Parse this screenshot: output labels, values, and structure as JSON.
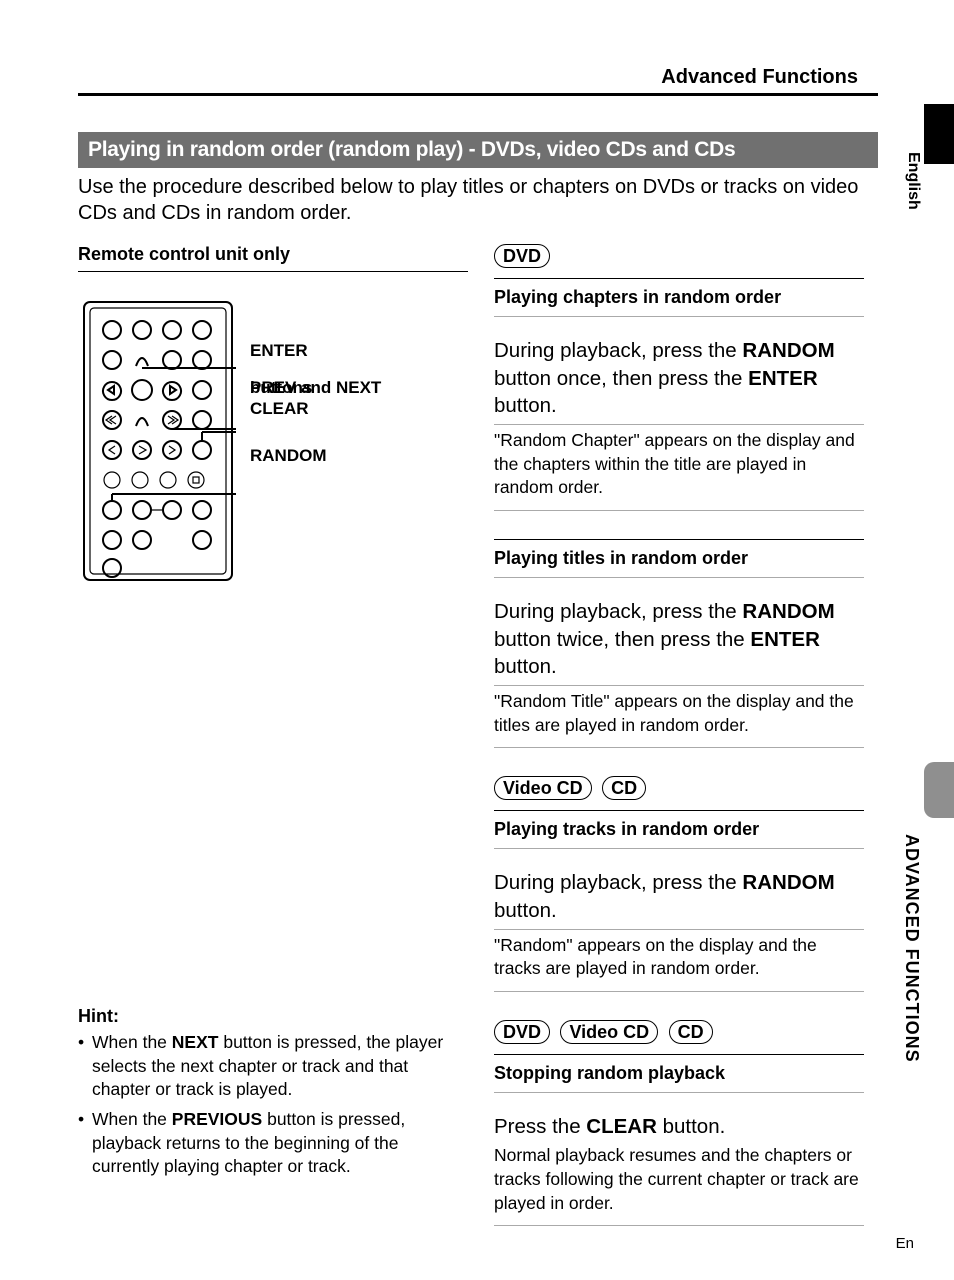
{
  "header": {
    "title": "Advanced Functions"
  },
  "side": {
    "language": "English",
    "section": "ADVANCED FUNCTIONS"
  },
  "footer": {
    "code": "En"
  },
  "section_bar": "Playing in random order (random play) - DVDs, video CDs and CDs",
  "intro": "Use the procedure described below to play titles or chapters on DVDs or tracks on video CDs and CDs in random order.",
  "remote": {
    "label": "Remote control unit only",
    "labels": {
      "enter": "ENTER",
      "prevnext1": "PREV and NEXT",
      "prevnext2": "buttons",
      "clear": "CLEAR",
      "random": "RANDOM"
    }
  },
  "hint": {
    "title": "Hint:",
    "items": [
      {
        "pre": "When the ",
        "bold": "NEXT",
        "post": " button is pressed, the player selects the next chapter or track and that chapter or track is played."
      },
      {
        "pre": "When the ",
        "bold": "PREVIOUS",
        "post": " button is pressed, playback returns to the beginning of the currently playing chapter or track."
      }
    ]
  },
  "right": {
    "block1": {
      "pills": [
        "DVD"
      ],
      "heading": "Playing chapters in random order",
      "step_p1": "During playback, press the ",
      "step_b1": "RANDOM",
      "step_p2": " button once, then press the ",
      "step_b2": "ENTER",
      "step_p3": " button.",
      "desc": "\"Random Chapter\" appears on the display and the chapters within the title are played in random order."
    },
    "block2": {
      "heading": "Playing titles in random order",
      "step_p1": "During playback, press the ",
      "step_b1": "RANDOM",
      "step_p2": " button twice, then press the ",
      "step_b2": "ENTER",
      "step_p3": " button.",
      "desc": "\"Random Title\" appears on the display and the titles are played in random order."
    },
    "block3": {
      "pills": [
        "Video CD",
        "CD"
      ],
      "heading": "Playing tracks in random order",
      "step_p1": "During playback, press the ",
      "step_b1": "RANDOM",
      "step_p2": " button.",
      "desc": "\"Random\" appears on the display and the tracks are played in random order."
    },
    "block4": {
      "pills": [
        "DVD",
        "Video CD",
        "CD"
      ],
      "heading": "Stopping random playback",
      "step_p1": "Press the ",
      "step_b1": "CLEAR",
      "step_p2": " button.",
      "desc": "Normal playback resumes and the chapters or tracks following the current chapter or track are played in order."
    }
  }
}
